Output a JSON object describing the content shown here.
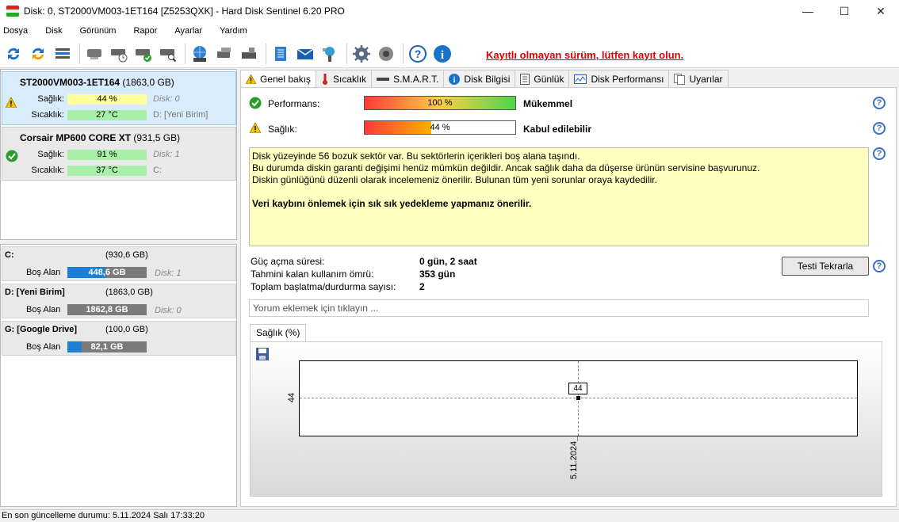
{
  "window": {
    "title": "Disk: 0, ST2000VM003-1ET164 [Z5253QXK]  -  Hard Disk Sentinel 6.20 PRO",
    "minimize": "—",
    "maximize": "☐",
    "close": "✕"
  },
  "menu": [
    "Dosya",
    "Disk",
    "Görünüm",
    "Rapor",
    "Ayarlar",
    "Yardım"
  ],
  "toolbar": {
    "unregistered": "Kayıtlı olmayan sürüm, lütfen kayıt olun."
  },
  "disks": [
    {
      "name": "ST2000VM003-1ET164",
      "size": "(1863,0 GB)",
      "health_label": "Sağlık:",
      "health": "44 %",
      "health_pct": 44,
      "health_color": "#ffff9c",
      "temp_label": "Sıcaklık:",
      "temp": "27 °C",
      "temp_color": "#a8f0a8",
      "disk_index": "Disk: 0",
      "volume": "D: [Yeni Birim]",
      "status": "warning"
    },
    {
      "name": "Corsair MP600 CORE XT",
      "size": "(931,5 GB)",
      "health_label": "Sağlık:",
      "health": "91 %",
      "health_pct": 91,
      "health_color": "#a8f0a8",
      "temp_label": "Sıcaklık:",
      "temp": "37 °C",
      "temp_color": "#a8f0a8",
      "disk_index": "Disk: 1",
      "volume": "C:",
      "status": "ok"
    }
  ],
  "volumes": [
    {
      "name": "C:",
      "size": "(930,6 GB)",
      "free_label": "Boş Alan",
      "free": "448,6 GB",
      "free_fraction": 0.48,
      "disk": "Disk: 1"
    },
    {
      "name": "D: [Yeni Birim]",
      "size": "(1863,0 GB)",
      "free_label": "Boş Alan",
      "free": "1862,8 GB",
      "free_fraction": 0.0,
      "disk": "Disk: 0"
    },
    {
      "name": "G: [Google Drive]",
      "size": "(100,0 GB)",
      "free_label": "Boş Alan",
      "free": "82,1 GB",
      "free_fraction": 0.18,
      "disk": ""
    }
  ],
  "tabs": [
    "Genel bakış",
    "Sıcaklık",
    "S.M.A.R.T.",
    "Disk Bilgisi",
    "Günlük",
    "Disk Performansı",
    "Uyarılar"
  ],
  "overview": {
    "performance_label": "Performans:",
    "performance_value": "100 %",
    "performance_pct": 100,
    "performance_desc": "Mükemmel",
    "health_label": "Sağlık:",
    "health_value": "44 %",
    "health_pct": 44,
    "health_desc": "Kabul edilebilir",
    "message_lines": [
      "Disk yüzeyinde 56 bozuk sektör var. Bu sektörlerin içerikleri boş alana taşındı.",
      "Bu durumda diskin garanti değişimi henüz mümkün değildir. Ancak sağlık daha da düşerse ürünün servisine başvurunuz.",
      "Diskin günlüğünü düzenli olarak incelemeniz önerilir. Bulunan tüm yeni sorunlar oraya kaydedilir."
    ],
    "message_bold": "Veri kaybını önlemek için sık sık yedekleme yapmanız önerilir.",
    "power_on_label": "Güç açma süresi:",
    "power_on": "0 gün, 2 saat",
    "lifetime_label": "Tahmini kalan kullanım ömrü:",
    "lifetime": "353 gün",
    "starts_label": "Toplam başlatma/durdurma sayısı:",
    "starts": "2",
    "retest_button": "Testi Tekrarla",
    "comment_placeholder": "Yorum eklemek için tıklayın ...",
    "help": "?"
  },
  "graph": {
    "tab": "Sağlık (%)"
  },
  "chart_data": {
    "type": "line",
    "title": "Sağlık (%)",
    "x": [
      "5.11.2024"
    ],
    "series": [
      {
        "values": [
          44
        ]
      }
    ],
    "point_label": "44",
    "ytick": "44",
    "xtick": "5.11.2024"
  },
  "statusbar": "En son güncelleme durumu: 5.11.2024 Salı 17:33:20"
}
